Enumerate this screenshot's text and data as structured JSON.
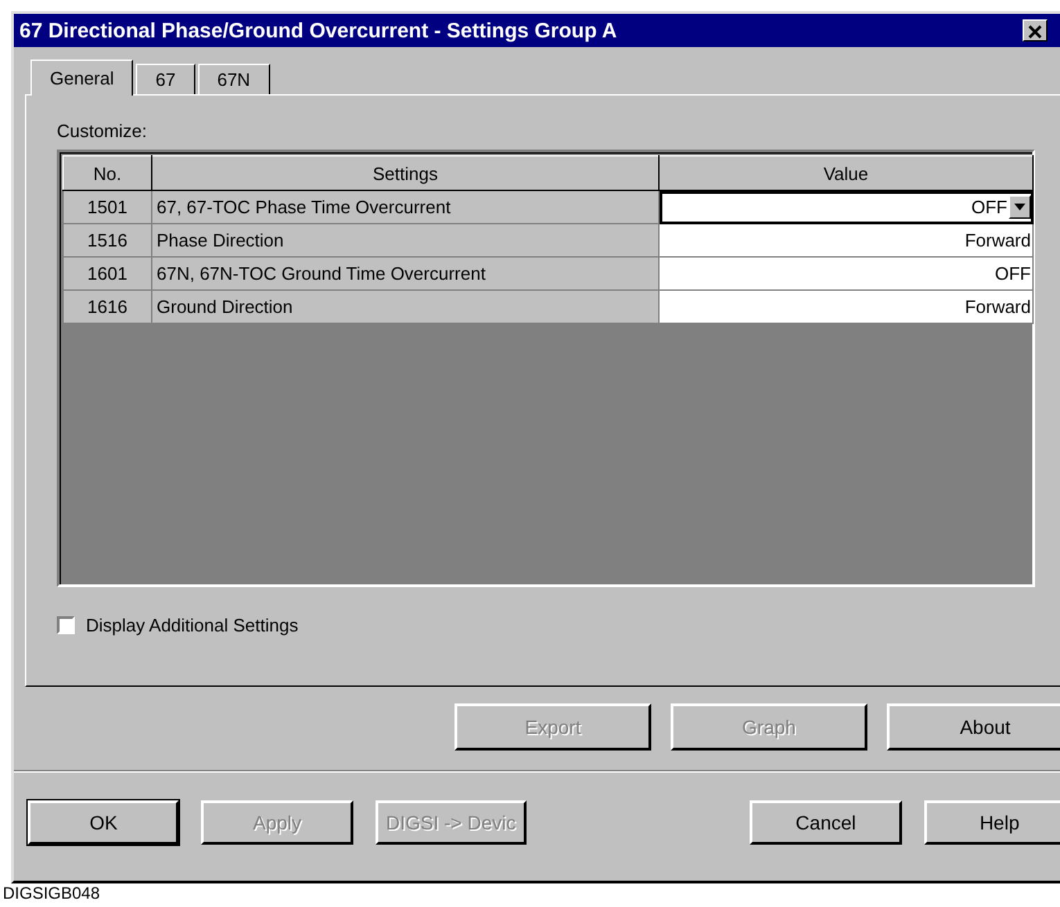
{
  "window": {
    "title": "67 Directional Phase/Ground Overcurrent - Settings Group A"
  },
  "tabs": [
    {
      "label": "General",
      "selected": true
    },
    {
      "label": "67",
      "selected": false
    },
    {
      "label": "67N",
      "selected": false
    }
  ],
  "customize_label": "Customize:",
  "table": {
    "columns": [
      "No.",
      "Settings",
      "Value"
    ],
    "rows": [
      {
        "no": "1501",
        "setting": "67, 67-TOC Phase Time Overcurrent",
        "value": "OFF",
        "kind": "dropdown",
        "selected": true
      },
      {
        "no": "1516",
        "setting": "Phase Direction",
        "value": "Forward",
        "kind": "text",
        "selected": false
      },
      {
        "no": "1601",
        "setting": "67N, 67N-TOC Ground Time Overcurrent",
        "value": "OFF",
        "kind": "text",
        "selected": false
      },
      {
        "no": "1616",
        "setting": "Ground Direction",
        "value": "Forward",
        "kind": "text",
        "selected": false
      }
    ]
  },
  "display_additional": {
    "label": "Display Additional Settings",
    "checked": false
  },
  "panel_buttons": [
    {
      "label": "Export",
      "disabled": true
    },
    {
      "label": "Graph",
      "disabled": true
    },
    {
      "label": "About",
      "disabled": false
    }
  ],
  "dialog_buttons": [
    {
      "label": "OK",
      "disabled": false,
      "default": true
    },
    {
      "label": "Apply",
      "disabled": true,
      "default": false
    },
    {
      "label": "DIGSI -> Devic",
      "disabled": true,
      "default": false
    },
    {
      "label": "Cancel",
      "disabled": false,
      "default": false
    },
    {
      "label": "Help",
      "disabled": false,
      "default": false
    }
  ],
  "caption": "DIGSIGB048"
}
